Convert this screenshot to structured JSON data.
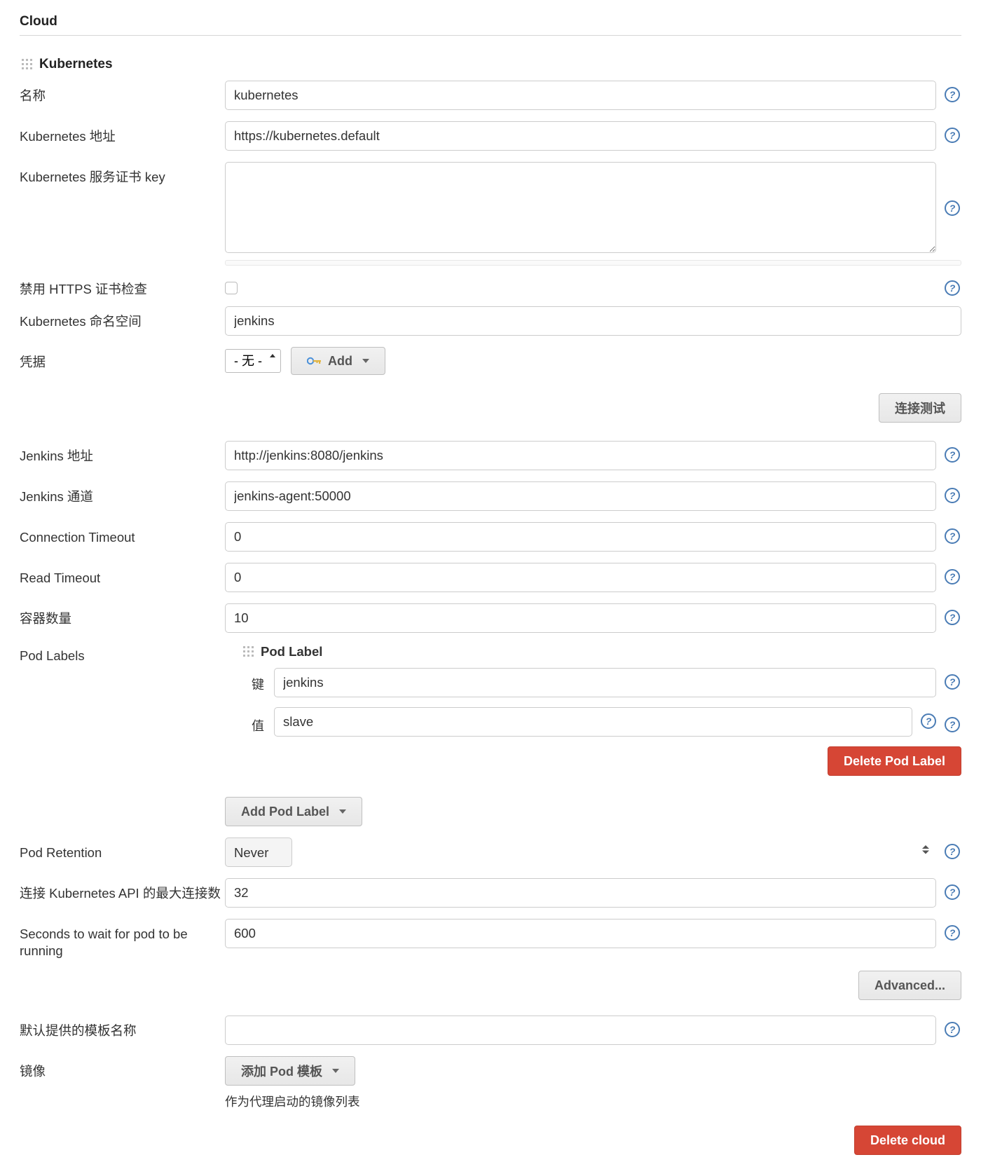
{
  "section_title": "Cloud",
  "sub_title": "Kubernetes",
  "labels": {
    "name": "名称",
    "k8s_url": "Kubernetes 地址",
    "server_cert_key": "Kubernetes 服务证书 key",
    "disable_https_check": "禁用 HTTPS 证书检查",
    "namespace": "Kubernetes 命名空间",
    "credentials": "凭据",
    "test_connection": "连接测试",
    "jenkins_url": "Jenkins 地址",
    "jenkins_tunnel": "Jenkins 通道",
    "conn_timeout": "Connection Timeout",
    "read_timeout": "Read Timeout",
    "container_cap": "容器数量",
    "pod_labels": "Pod Labels",
    "pod_label_header": "Pod Label",
    "pod_label_key": "键",
    "pod_label_value": "值",
    "delete_pod_label": "Delete Pod Label",
    "add_pod_label": "Add Pod Label",
    "pod_retention": "Pod Retention",
    "max_connections": "连接 Kubernetes API 的最大连接数",
    "seconds_wait": "Seconds to wait for pod to be running",
    "advanced": "Advanced...",
    "default_template_name": "默认提供的模板名称",
    "images": "镜像",
    "add_pod_template": "添加 Pod 模板",
    "images_desc": "作为代理启动的镜像列表",
    "delete_cloud": "Delete cloud",
    "cred_none": "- 无 -",
    "add": "Add"
  },
  "values": {
    "name": "kubernetes",
    "k8s_url": "https://kubernetes.default",
    "server_cert_key": "",
    "namespace": "jenkins",
    "jenkins_url": "http://jenkins:8080/jenkins",
    "jenkins_tunnel": "jenkins-agent:50000",
    "conn_timeout": "0",
    "read_timeout": "0",
    "container_cap": "10",
    "pod_label_key": "jenkins",
    "pod_label_value": "slave",
    "pod_retention": "Never",
    "max_connections": "32",
    "seconds_wait": "600",
    "default_template_name": ""
  }
}
